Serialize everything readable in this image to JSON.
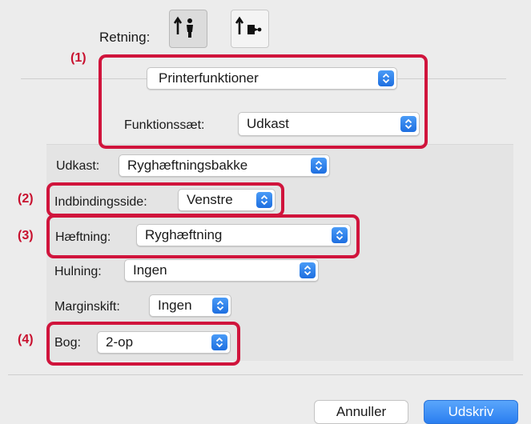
{
  "orientation": {
    "label": "Retning:",
    "options": [
      {
        "name": "portrait",
        "selected": true
      },
      {
        "name": "landscape",
        "selected": false
      }
    ]
  },
  "callouts": [
    "(1)",
    "(2)",
    "(3)",
    "(4)"
  ],
  "functions_popup": {
    "value": "Printerfunktioner"
  },
  "feature_set": {
    "label": "Funktionssæt:",
    "value": "Udkast"
  },
  "settings": {
    "output": {
      "label": "Udkast:",
      "value": "Ryghæftningsbakke"
    },
    "binding_edge": {
      "label": "Indbindingsside:",
      "value": "Venstre"
    },
    "staple": {
      "label": "Hæftning:",
      "value": "Ryghæftning"
    },
    "punch": {
      "label": "Hulning:",
      "value": "Ingen"
    },
    "margin_shift": {
      "label": "Marginskift:",
      "value": "Ingen"
    },
    "booklet": {
      "label": "Bog:",
      "value": "2-op"
    }
  },
  "buttons": {
    "cancel": "Annuller",
    "print": "Udskriv"
  },
  "colors": {
    "highlight": "#d0143c",
    "accent": "#2a7ef0"
  }
}
